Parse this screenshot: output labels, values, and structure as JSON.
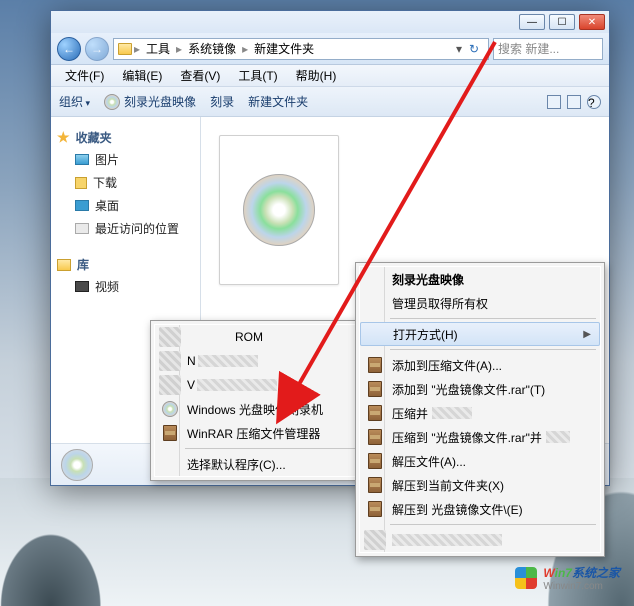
{
  "window": {
    "breadcrumbs": [
      "工具",
      "系统镜像",
      "新建文件夹"
    ],
    "search_placeholder": "搜索 新建...",
    "menus": [
      "文件(F)",
      "编辑(E)",
      "查看(V)",
      "工具(T)",
      "帮助(H)"
    ],
    "toolbar": {
      "organize": "组织",
      "burn_image": "刻录光盘映像",
      "burn": "刻录",
      "new_folder": "新建文件夹"
    },
    "sidebar": {
      "favorites": {
        "label": "收藏夹",
        "items": [
          "图片",
          "下载",
          "桌面",
          "最近访问的位置"
        ]
      },
      "libraries": {
        "label": "库",
        "items": [
          "视频"
        ]
      }
    }
  },
  "open_with_menu": {
    "redacted_suffix_0": "ROM",
    "redacted_prefix_1": "N",
    "redacted_prefix_2": "V",
    "item_3": "Windows 光盘映像刻录机",
    "item_4": "WinRAR 压缩文件管理器",
    "choose_default": "选择默认程序(C)..."
  },
  "context_menu": {
    "burn_image": "刻录光盘映像",
    "admin_own": "管理员取得所有权",
    "open_with": "打开方式(H)",
    "add_to_archive": "添加到压缩文件(A)...",
    "add_to_named": "添加到 \"光盘镜像文件.rar\"(T)",
    "compress_and": "压缩并",
    "compress_to_named": "压缩到 \"光盘镜像文件.rar\"并",
    "extract": "解压文件(A)...",
    "extract_here": "解压到当前文件夹(X)",
    "extract_to_named": "解压到 光盘镜像文件\\(E)"
  },
  "watermark": {
    "brand_red": "W",
    "brand_green": "in7",
    "brand_rest": "系统之家",
    "site": "Winwin7.com"
  }
}
